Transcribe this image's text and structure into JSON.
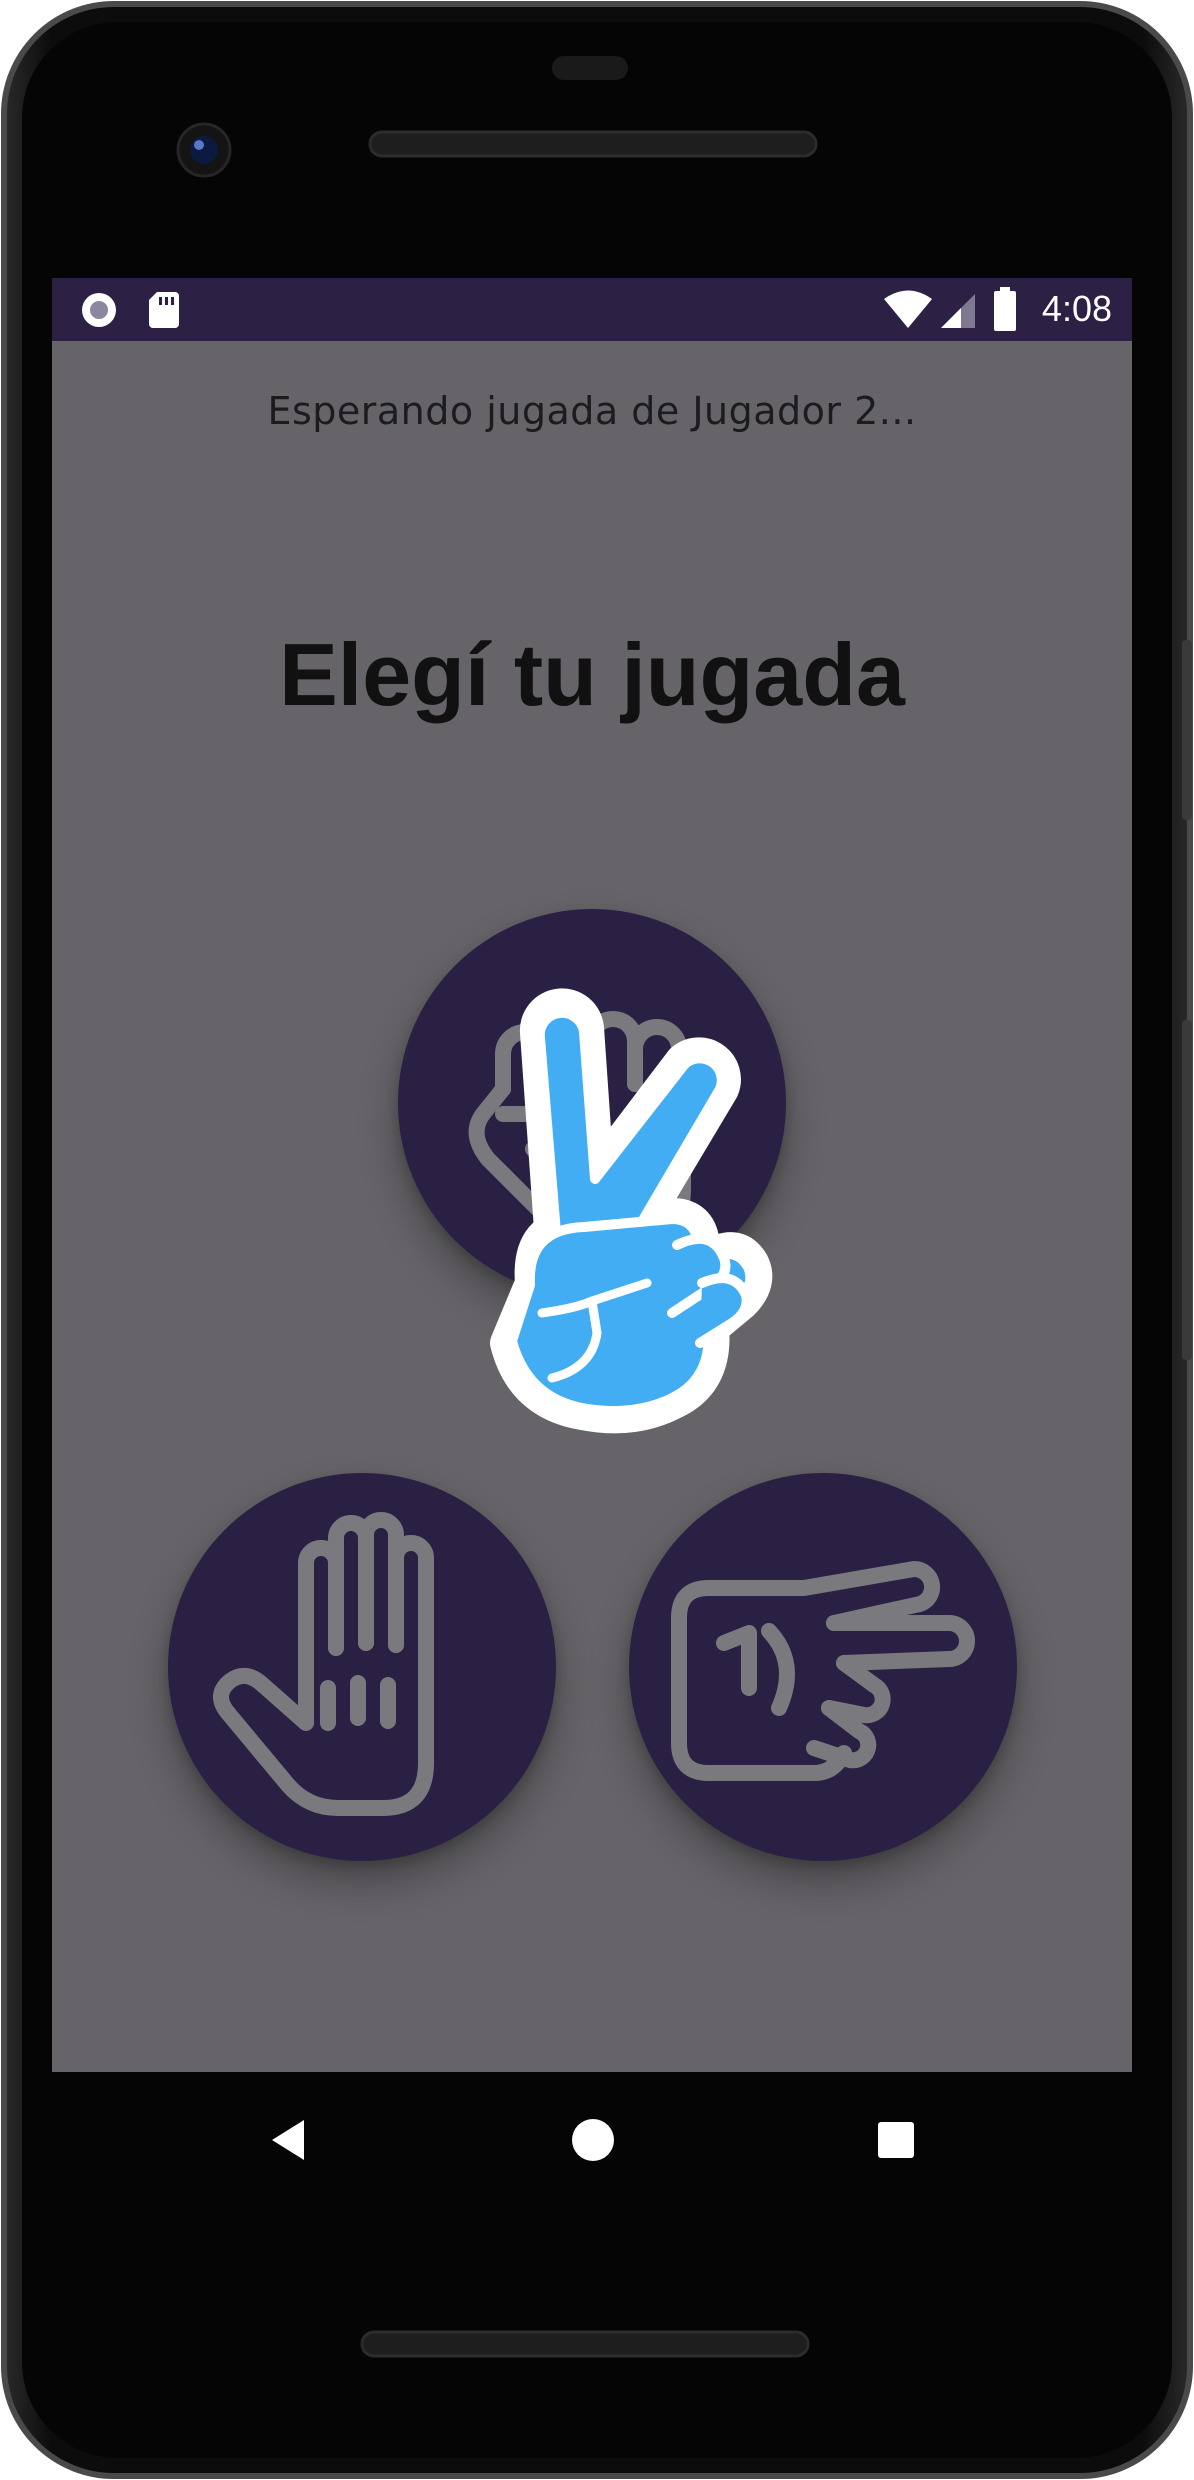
{
  "status_bar": {
    "time": "4:08",
    "icons": [
      "recording-icon",
      "sd-card-icon",
      "wifi-icon",
      "cell-signal-icon",
      "battery-icon"
    ]
  },
  "game": {
    "waiting_text": "Esperando jugada de Jugador 2...",
    "title": "Elegí tu jugada",
    "choices": [
      {
        "id": "rock",
        "icon": "fist-icon"
      },
      {
        "id": "paper",
        "icon": "open-hand-icon"
      },
      {
        "id": "scissors",
        "icon": "scissors-hand-icon"
      }
    ],
    "animated_icon": "peace-hand-icon"
  },
  "nav_bar": {
    "buttons": [
      "back",
      "home",
      "recents"
    ]
  },
  "colors": {
    "status_bar": "#2c2145",
    "screen_bg": "#666468",
    "button_bg": "#2a2043",
    "icon_outline": "#7a7a7e",
    "accent_blue": "#42adf2"
  }
}
